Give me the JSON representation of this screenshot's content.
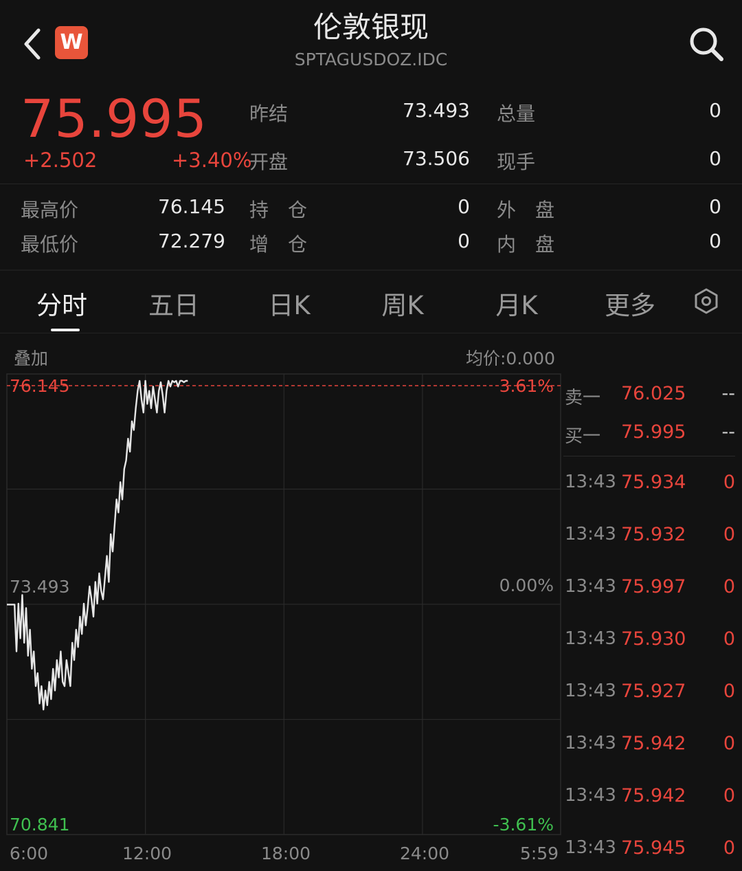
{
  "header": {
    "title": "伦敦银现",
    "subtitle": "SPTAGUSDOZ.IDC",
    "logo_letter": "W"
  },
  "quote": {
    "price": "75.995",
    "change": "+2.502",
    "change_pct": "+3.40%",
    "fields": [
      {
        "label": "昨结",
        "value": "73.493"
      },
      {
        "label": "总量",
        "value": "0"
      },
      {
        "label": "开盘",
        "value": "73.506"
      },
      {
        "label": "现手",
        "value": "0"
      },
      {
        "label": "最高价",
        "value": "76.145"
      },
      {
        "label": "持　仓",
        "value": "0"
      },
      {
        "label": "外　盘",
        "value": "0"
      },
      {
        "label": "最低价",
        "value": "72.279"
      },
      {
        "label": "增　仓",
        "value": "0"
      },
      {
        "label": "内　盘",
        "value": "0"
      }
    ]
  },
  "tabs": [
    "分时",
    "五日",
    "日K",
    "周K",
    "月K",
    "更多"
  ],
  "chart_header": {
    "overlay_label": "叠加",
    "avg_price_label": "均价:0.000"
  },
  "chart_data": {
    "type": "line",
    "y_top_label": "76.145",
    "y_mid_label": "73.493",
    "y_bottom_label": "70.841",
    "pct_top_label": "3.61%",
    "pct_mid_label": "0.00%",
    "pct_bottom_label": "-3.61%",
    "x_tick_labels": [
      "6:00",
      "12:00",
      "18:00",
      "24:00",
      "5:59"
    ],
    "ylim": [
      70.841,
      76.145
    ],
    "prev_close": 73.493,
    "session_minutes": 1439,
    "series": [
      {
        "x": [
          0,
          20,
          21,
          25,
          30,
          35,
          40,
          45,
          50,
          55,
          60,
          65,
          70,
          75,
          80,
          85,
          90,
          95,
          100,
          105,
          110,
          115,
          120,
          125,
          130,
          135,
          140,
          145,
          150,
          155,
          160,
          165,
          170,
          175,
          180,
          185,
          190,
          195,
          200,
          205,
          210,
          215,
          220,
          225,
          230,
          235,
          240,
          245,
          250,
          255,
          260,
          265,
          270,
          275,
          280,
          285,
          290,
          295,
          300,
          305,
          310,
          315,
          320,
          325,
          330,
          335,
          340,
          345,
          350,
          355,
          360,
          365,
          370,
          375,
          380,
          385,
          390,
          395,
          400,
          405,
          410,
          415,
          420,
          425,
          430,
          435,
          440,
          445,
          450,
          455,
          460,
          465,
          470
        ],
        "values": [
          73.49,
          73.49,
          73.35,
          72.95,
          73.5,
          73.1,
          73.6,
          73.05,
          73.45,
          72.9,
          73.2,
          72.75,
          72.95,
          72.55,
          72.7,
          72.35,
          72.55,
          72.28,
          72.5,
          72.33,
          72.6,
          72.4,
          72.75,
          72.5,
          72.85,
          72.65,
          72.95,
          72.6,
          72.55,
          72.85,
          72.7,
          72.55,
          73.05,
          72.85,
          73.2,
          73.0,
          73.35,
          73.15,
          73.5,
          73.25,
          73.45,
          73.7,
          73.55,
          73.35,
          73.75,
          73.5,
          73.85,
          73.65,
          73.55,
          73.8,
          74.05,
          73.75,
          74.3,
          74.1,
          74.4,
          74.7,
          74.55,
          74.9,
          74.7,
          75.05,
          75.15,
          75.4,
          75.25,
          75.6,
          75.5,
          75.75,
          75.95,
          76.1,
          75.85,
          75.7,
          76.14,
          75.8,
          75.95,
          75.75,
          76.0,
          75.85,
          75.7,
          75.95,
          76.05,
          75.9,
          75.7,
          75.95,
          76.14,
          76.0,
          76.14,
          76.05,
          76.14,
          76.0,
          76.1,
          76.14,
          76.05,
          76.14,
          76.1
        ]
      }
    ]
  },
  "order_book": {
    "ask": {
      "label": "卖一",
      "price": "76.025",
      "vol": "--"
    },
    "bid": {
      "label": "买一",
      "price": "75.995",
      "vol": "--"
    },
    "trades": [
      {
        "time": "13:43",
        "price": "75.934",
        "vol": "0"
      },
      {
        "time": "13:43",
        "price": "75.932",
        "vol": "0"
      },
      {
        "time": "13:43",
        "price": "75.997",
        "vol": "0"
      },
      {
        "time": "13:43",
        "price": "75.930",
        "vol": "0"
      },
      {
        "time": "13:43",
        "price": "75.927",
        "vol": "0"
      },
      {
        "time": "13:43",
        "price": "75.942",
        "vol": "0"
      },
      {
        "time": "13:43",
        "price": "75.942",
        "vol": "0"
      },
      {
        "time": "13:43",
        "price": "75.945",
        "vol": "0"
      }
    ]
  },
  "colors": {
    "background": "#121212",
    "up": "#e8453c",
    "down": "#3fbf4f",
    "line": "#e6e6e6",
    "grid": "#2a2a2a"
  }
}
